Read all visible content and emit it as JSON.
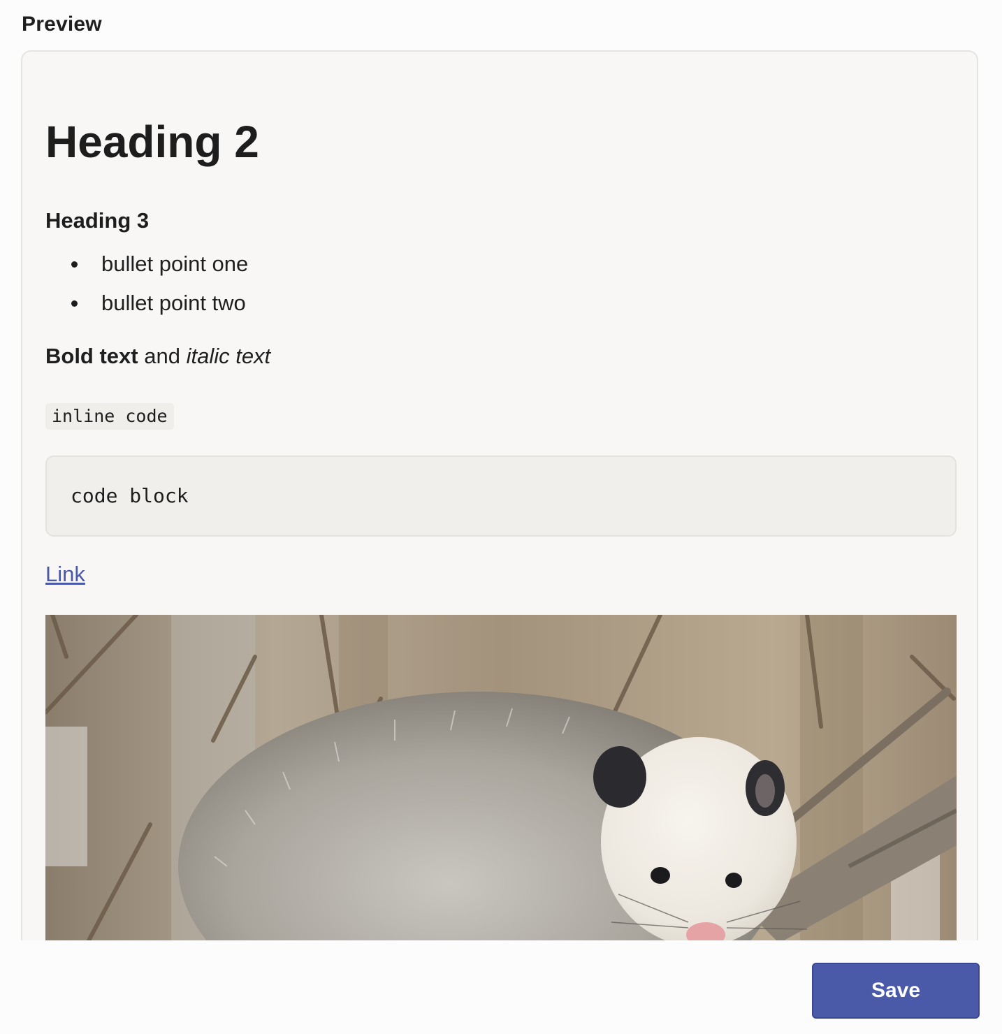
{
  "preview": {
    "label": "Preview"
  },
  "content": {
    "heading2": "Heading 2",
    "heading3": "Heading 3",
    "bullets": [
      "bullet point one",
      "bullet point two"
    ],
    "bold_text": "Bold text",
    "connector_text": " and ",
    "italic_text": "italic text",
    "inline_code": "inline code",
    "code_block": "code block",
    "link_text": "Link",
    "link_color": "#4a58a8"
  },
  "footer": {
    "save_label": "Save",
    "save_color": "#4b5aa8"
  }
}
